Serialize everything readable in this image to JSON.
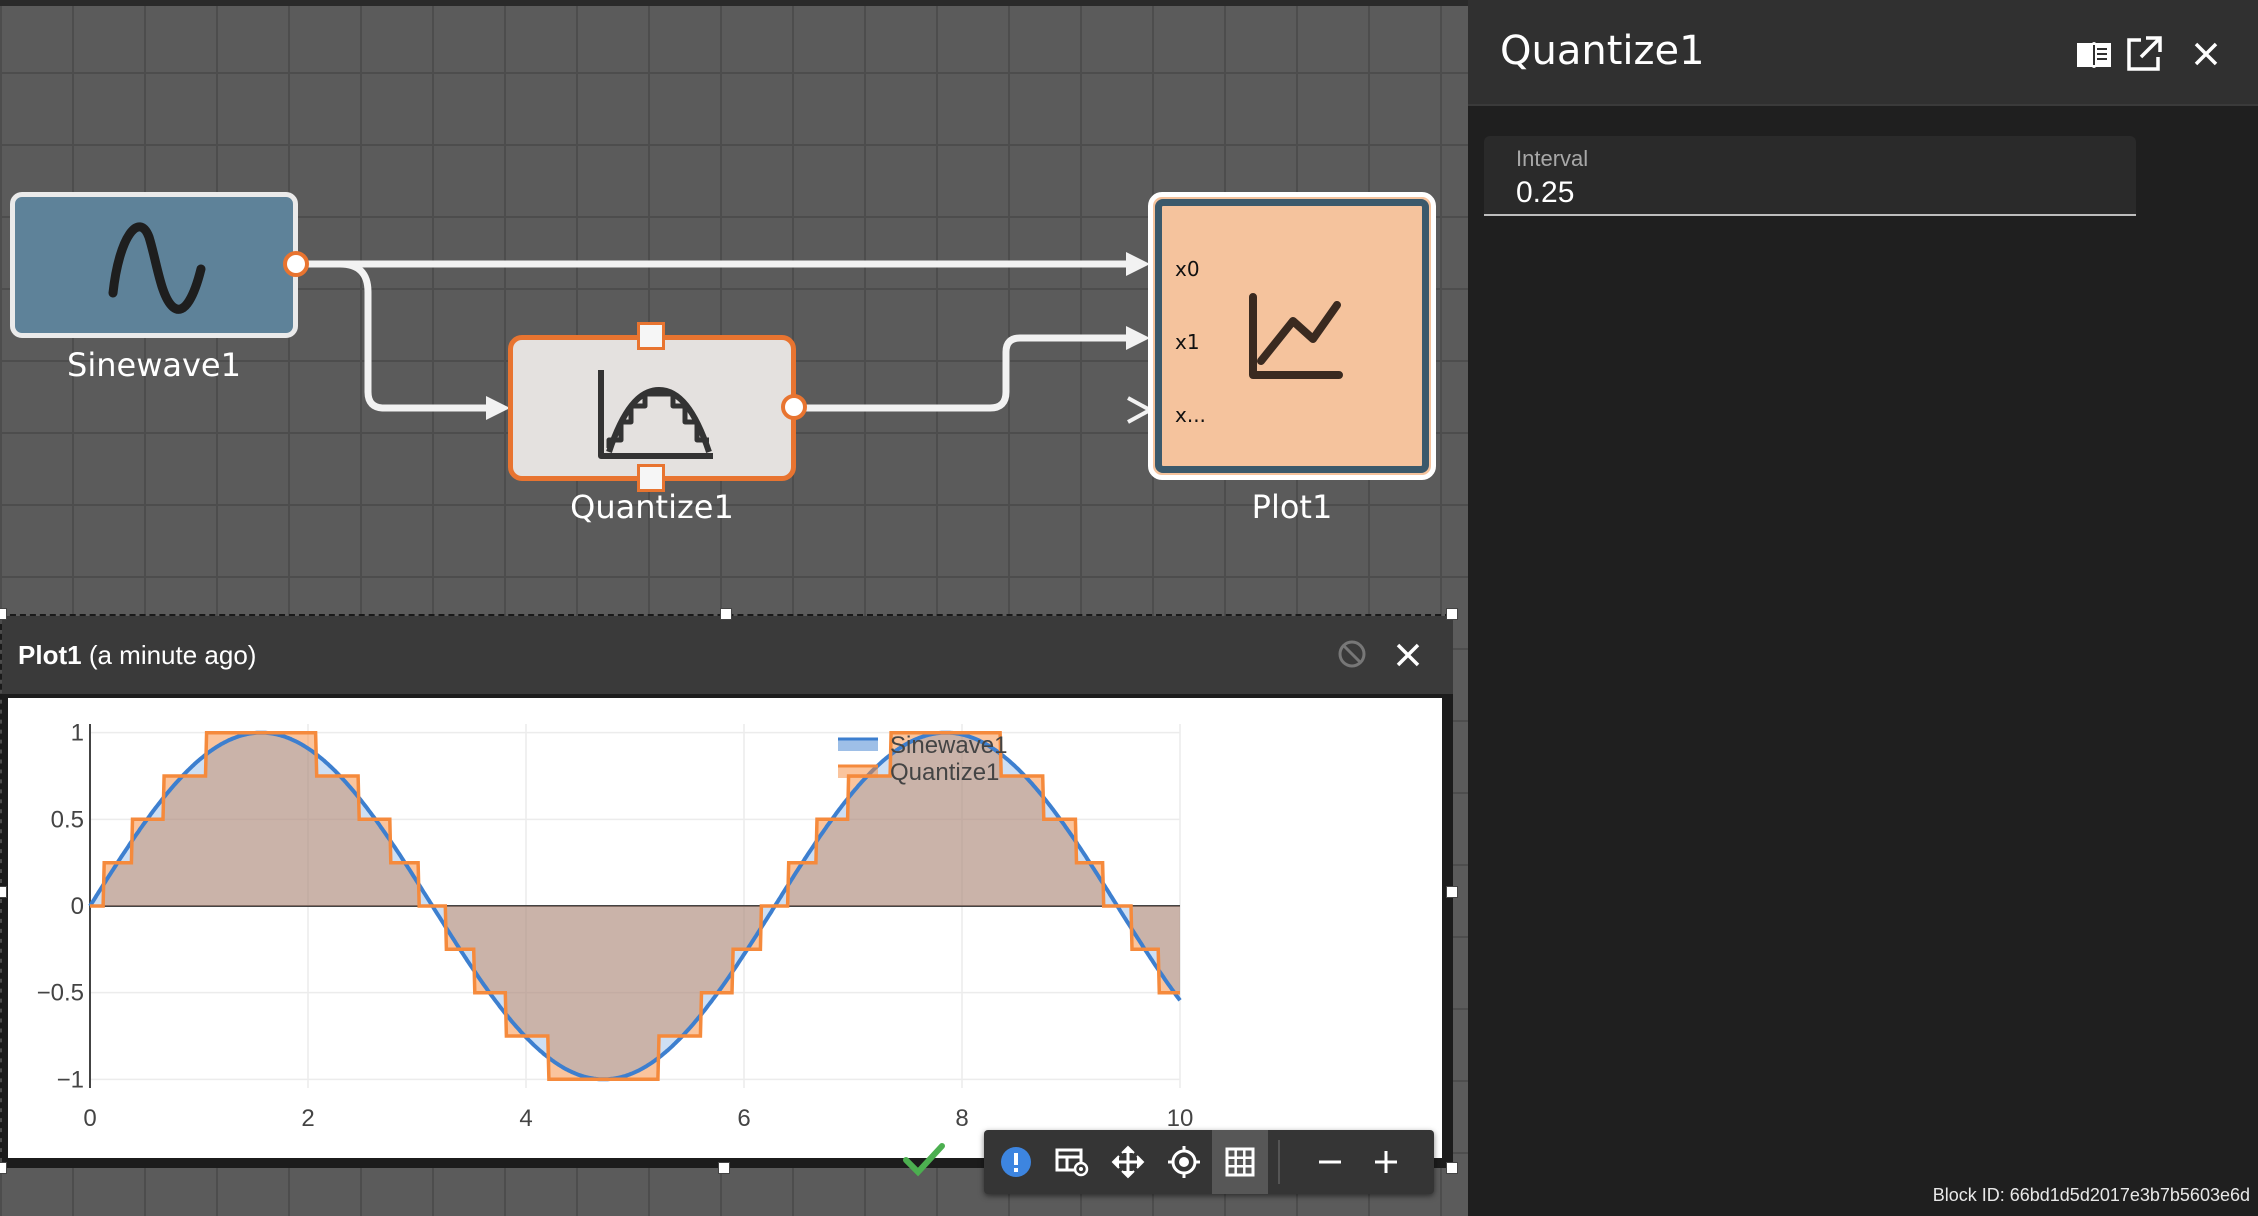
{
  "diagram": {
    "blocks": {
      "sinewave": {
        "label": "Sinewave1"
      },
      "quantize": {
        "label": "Quantize1"
      },
      "plot": {
        "label": "Plot1",
        "ports": [
          "x0",
          "x1",
          "x..."
        ]
      }
    }
  },
  "panel": {
    "title": "Quantize1",
    "field": {
      "label": "Interval",
      "value": "0.25"
    },
    "block_id": "Block ID: 66bd1d5d2017e3b7b5603e6d"
  },
  "plot_window": {
    "title": "Plot1",
    "subtitle": "(a minute ago)"
  },
  "chart_data": {
    "type": "area",
    "x_range": [
      0,
      10
    ],
    "y_range": [
      -1.05,
      1.05
    ],
    "x_ticks": [
      "0",
      "2",
      "4",
      "6",
      "8",
      "10"
    ],
    "y_ticks": [
      "1",
      "0.5",
      "0",
      "−0.5",
      "−1"
    ],
    "x_tick_values": [
      0,
      2,
      4,
      6,
      8,
      10
    ],
    "y_tick_values": [
      1,
      0.5,
      0,
      -0.5,
      -1
    ],
    "grid": true,
    "legend_position": "top-right",
    "series": [
      {
        "name": "Sinewave1",
        "color": "#3d7fcf",
        "function": "sin(x)",
        "x_start": 0,
        "x_end": 10
      },
      {
        "name": "Quantize1",
        "color": "#f58a3c",
        "function": "round(sin(x)/0.25)*0.25",
        "x_start": 0,
        "x_end": 10,
        "interval": 0.25
      }
    ]
  },
  "colors": {
    "canvas": "#5b5b5b",
    "sine_block": "#5e8299",
    "quantize_block": "#e4e1df",
    "quantize_border": "#e87430",
    "plot_block": "#f5c39d",
    "plot_border": "#3b596b"
  },
  "icons": {
    "docs": "book-icon",
    "external": "open-external-icon",
    "close": "close-icon",
    "info": "info-icon",
    "table_view": "table-view-icon",
    "pan": "move-icon",
    "target": "crosshair-icon",
    "grid": "grid-icon",
    "zoom_out": "minus-icon",
    "zoom_in": "plus-icon",
    "check": "check-icon",
    "clear": "block-icon"
  }
}
